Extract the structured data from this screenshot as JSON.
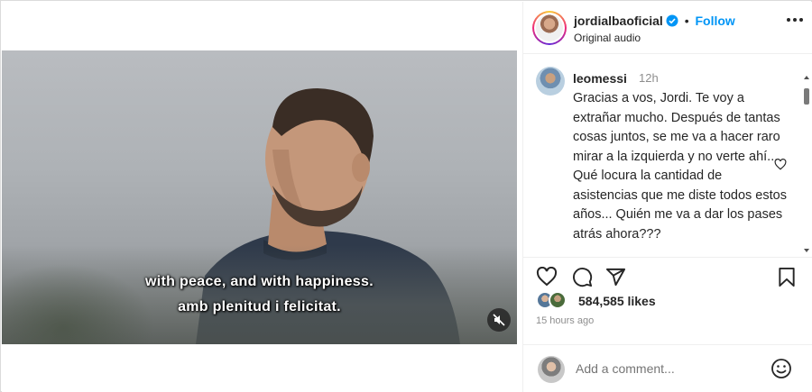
{
  "post": {
    "username": "jordialbaoficial",
    "follow_label": "Follow",
    "separator": "•",
    "audio": "Original audio"
  },
  "video": {
    "subtitle_line1": "with peace, and with happiness.",
    "subtitle_line2": "amb plenitud i felicitat."
  },
  "comment": {
    "username": "leomessi",
    "time": "12h",
    "text": "Gracias a vos, Jordi. Te voy a extrañar mucho. Después de tantas cosas juntos, se me va a hacer raro mirar a la izquierda y no verte ahí... Qué locura la cantidad de asistencias que me diste todos estos años... Quién me va a dar los pases atrás ahora???"
  },
  "engagement": {
    "likes": "584,585 likes",
    "posted_ago": "15 hours ago"
  },
  "composer": {
    "placeholder": "Add a comment..."
  },
  "colors": {
    "accent": "#0095f6",
    "text": "#262626",
    "muted": "#8e8e8e"
  },
  "icons": [
    "verified-badge-icon",
    "more-options-icon",
    "heart-icon",
    "comment-icon",
    "share-icon",
    "bookmark-icon",
    "mute-icon",
    "emoji-icon"
  ]
}
